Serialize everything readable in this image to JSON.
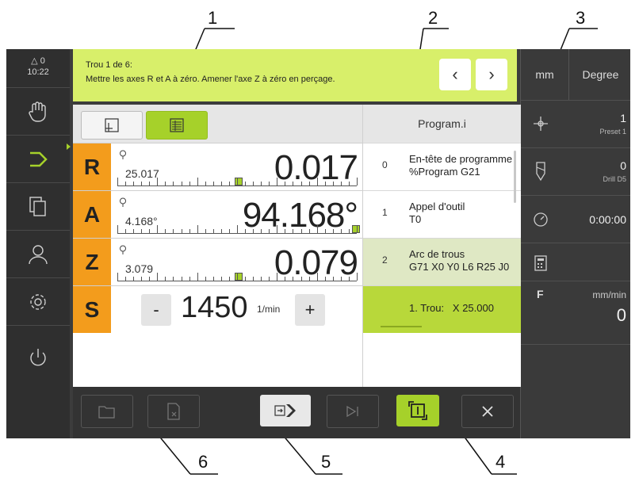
{
  "callouts": [
    "1",
    "2",
    "3",
    "4",
    "5",
    "6"
  ],
  "status": {
    "delta": "△ 0",
    "time": "10:22"
  },
  "message": {
    "line1": "Trou 1 de 6:",
    "line2": "Mettre les axes R et A à zéro. Amener l'axe Z à zéro en perçage."
  },
  "right_panel": {
    "unit_mm": "mm",
    "unit_degree": "Degree",
    "preset_value": "1",
    "preset_label": "Preset 1",
    "tool_value": "0",
    "tool_label": "Drill D5",
    "timer": "0:00:00",
    "feed_label": "F",
    "feed_unit": "mm/min",
    "feed_value": "0"
  },
  "axes": [
    {
      "label": "R",
      "small": "25.017",
      "value": "0.017"
    },
    {
      "label": "A",
      "small": "4.168°",
      "value": "94.168°"
    },
    {
      "label": "Z",
      "small": "3.079",
      "value": "0.079"
    }
  ],
  "spindle": {
    "label": "S",
    "minus": "-",
    "value": "1450",
    "unit": "1/min",
    "plus": "+"
  },
  "program": {
    "title": "Program.i",
    "rows": [
      {
        "num": "0",
        "line1": "En-tête de programme",
        "line2": "%Program G21"
      },
      {
        "num": "1",
        "line1": "Appel d'outil",
        "line2": "T0"
      },
      {
        "num": "2",
        "line1": "Arc de trous",
        "line2": "G71 X0 Y0 L6 R25 J0"
      }
    ],
    "current_step": "1. Trou:   X 25.000"
  },
  "colors": {
    "accent": "#a6d12a",
    "axis": "#f39c1c",
    "message": "#d8ef6a"
  }
}
